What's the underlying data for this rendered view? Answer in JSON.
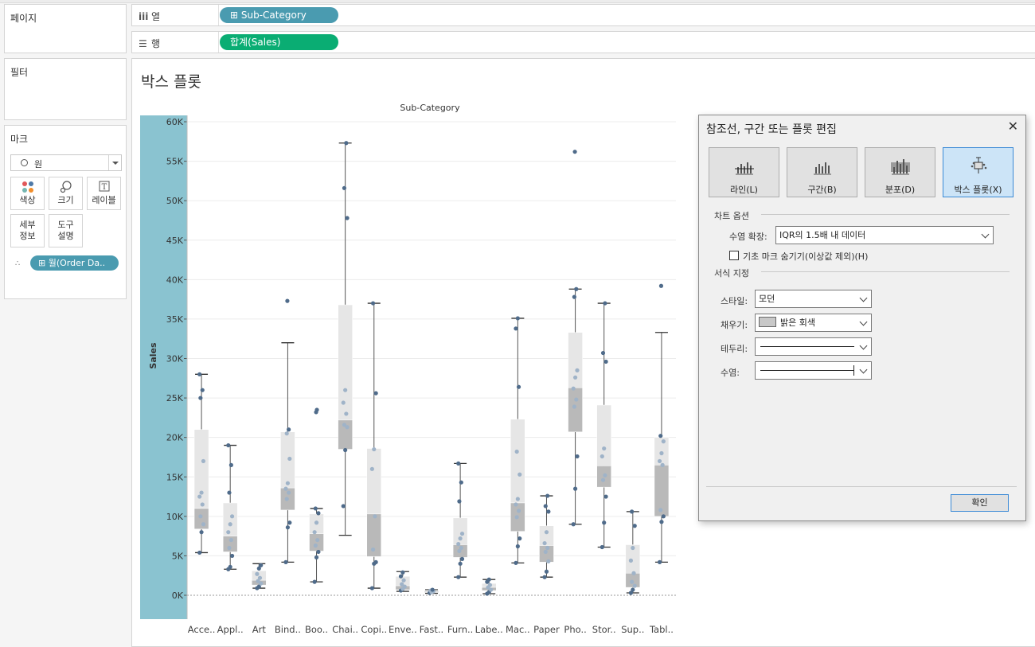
{
  "left": {
    "pages_title": "페이지",
    "filters_title": "필터",
    "marks_title": "마크",
    "mark_type": "원",
    "buttons": {
      "color": "색상",
      "size": "크기",
      "label": "레이블",
      "detail": "세부\n정보",
      "tooltip": "도구\n설명"
    },
    "detail_pill": "월(Order Da.."
  },
  "shelves": {
    "columns_label": "열",
    "rows_label": "행",
    "columns_pill": "Sub-Category",
    "rows_pill": "합계(Sales)"
  },
  "view": {
    "title": "박스 플롯"
  },
  "chart_data": {
    "type": "box",
    "title": "Sub-Category",
    "ylabel": "Sales",
    "ylim": [
      0,
      60000
    ],
    "yticks": [
      "0K",
      "5K",
      "10K",
      "15K",
      "20K",
      "25K",
      "30K",
      "35K",
      "40K",
      "45K",
      "50K",
      "55K",
      "60K"
    ],
    "categories": [
      "Acce..",
      "Appl..",
      "Art",
      "Bind..",
      "Boo..",
      "Chai..",
      "Copi..",
      "Enve..",
      "Fast..",
      "Furn..",
      "Labe..",
      "Mac..",
      "Paper",
      "Pho..",
      "Stor..",
      "Sup..",
      "Tabl.."
    ],
    "boxes": [
      {
        "lw": 5400,
        "q1": 8400,
        "med": 11000,
        "q3": 21000,
        "uw": 28000,
        "points": [
          5400,
          8000,
          9000,
          10000,
          11500,
          12500,
          13000,
          17000,
          25000,
          26000,
          28000
        ],
        "outliers": []
      },
      {
        "lw": 3300,
        "q1": 5500,
        "med": 7500,
        "q3": 11700,
        "uw": 19000,
        "points": [
          3300,
          3600,
          5000,
          6000,
          7000,
          8000,
          9000,
          10000,
          13000,
          16500,
          19000
        ],
        "outliers": []
      },
      {
        "lw": 900,
        "q1": 1300,
        "med": 1900,
        "q3": 3100,
        "uw": 4000,
        "points": [
          900,
          1100,
          1500,
          1800,
          2200,
          2700,
          3400,
          3800
        ],
        "outliers": []
      },
      {
        "lw": 4200,
        "q1": 10800,
        "med": 13600,
        "q3": 20700,
        "uw": 32000,
        "points": [
          4200,
          8600,
          9200,
          12200,
          13000,
          13500,
          14200,
          17300,
          20500,
          21000
        ],
        "outliers": [
          37300
        ]
      },
      {
        "lw": 1700,
        "q1": 5600,
        "med": 7800,
        "q3": 10300,
        "uw": 11000,
        "points": [
          1700,
          4800,
          5500,
          6300,
          7000,
          8000,
          9200,
          10400,
          11000
        ],
        "outliers": [
          23200,
          23500
        ]
      },
      {
        "lw": 7600,
        "q1": 18500,
        "med": 22200,
        "q3": 36800,
        "uw": 57300,
        "points": [
          11300,
          18400,
          21300,
          21600,
          23000,
          24400,
          26000,
          47800,
          51600,
          57300
        ],
        "outliers": []
      },
      {
        "lw": 900,
        "q1": 4900,
        "med": 10300,
        "q3": 18600,
        "uw": 37000,
        "points": [
          900,
          4000,
          4200,
          5800,
          10000,
          16000,
          18500,
          25600,
          37000
        ],
        "outliers": []
      },
      {
        "lw": 500,
        "q1": 700,
        "med": 1200,
        "q3": 2400,
        "uw": 3000,
        "points": [
          600,
          800,
          1100,
          1400,
          1900,
          2400,
          2900
        ],
        "outliers": []
      },
      {
        "lw": 250,
        "q1": 350,
        "med": 480,
        "q3": 620,
        "uw": 700,
        "points": [
          300,
          400,
          500,
          600,
          700
        ],
        "outliers": []
      },
      {
        "lw": 2300,
        "q1": 4800,
        "med": 6400,
        "q3": 9800,
        "uw": 16700,
        "points": [
          2300,
          4000,
          4600,
          5600,
          6000,
          6500,
          7200,
          7800,
          11900,
          14300,
          16700
        ],
        "outliers": []
      },
      {
        "lw": 200,
        "q1": 600,
        "med": 1000,
        "q3": 1500,
        "uw": 2000,
        "points": [
          200,
          400,
          700,
          1000,
          1300,
          1700,
          2000
        ],
        "outliers": []
      },
      {
        "lw": 4100,
        "q1": 8100,
        "med": 11700,
        "q3": 22300,
        "uw": 35100,
        "points": [
          4100,
          6200,
          7200,
          9900,
          10700,
          11500,
          12200,
          15300,
          18200,
          26400,
          33800,
          35100
        ],
        "outliers": []
      },
      {
        "lw": 2300,
        "q1": 4200,
        "med": 6300,
        "q3": 8800,
        "uw": 12600,
        "points": [
          2300,
          3000,
          4300,
          5500,
          6000,
          6600,
          8000,
          10600,
          11300,
          12600
        ],
        "outliers": []
      },
      {
        "lw": 9000,
        "q1": 20700,
        "med": 26300,
        "q3": 33300,
        "uw": 38800,
        "points": [
          9000,
          13500,
          17600,
          23900,
          24800,
          26200,
          27600,
          28500,
          37800,
          38800
        ],
        "outliers": [
          56200
        ]
      },
      {
        "lw": 6100,
        "q1": 13700,
        "med": 16400,
        "q3": 24100,
        "uw": 37000,
        "points": [
          6100,
          9200,
          12500,
          14600,
          15200,
          17600,
          18600,
          29600,
          30700,
          37000
        ],
        "outliers": []
      },
      {
        "lw": 300,
        "q1": 1000,
        "med": 2800,
        "q3": 6400,
        "uw": 10600,
        "points": [
          300,
          700,
          1200,
          1700,
          2800,
          4400,
          6000,
          8800,
          10600
        ],
        "outliers": []
      },
      {
        "lw": 4200,
        "q1": 10000,
        "med": 16500,
        "q3": 20000,
        "uw": 33300,
        "points": [
          4200,
          9300,
          10000,
          10800,
          16500,
          17000,
          18000,
          19500,
          20200
        ],
        "outliers": [
          39200
        ]
      }
    ]
  },
  "dialog": {
    "title": "참조선, 구간 또는 플롯 편집",
    "close": "✕",
    "types": [
      "라인(L)",
      "구간(B)",
      "분포(D)",
      "박스 플롯(X)"
    ],
    "active_type": "박스 플롯(X)",
    "chart_options_label": "차트 옵션",
    "whisker_label": "수염 확장:",
    "whisker_value": "IQR의 1.5배 내 데이터",
    "hide_marks_label": "기초 마크 숨기기(이상값 제외)(H)",
    "format_label": "서식 지정",
    "style_label": "스타일:",
    "style_value": "모던",
    "fill_label": "채우기:",
    "fill_value": "밝은 회색",
    "border_label": "테두리:",
    "whisker_line_label": "수염:",
    "ok": "확인"
  },
  "colors": {
    "pill_blue": "#4a9bb0",
    "pill_green": "#0aad73",
    "axis_band": "#8ac3d0",
    "box_upper": "#e6e6e6",
    "box_lower": "#b9b9b9",
    "dot": "#4f6b8a",
    "dot_light": "#9fb3c8",
    "dialog_active": "#cce4f7"
  }
}
